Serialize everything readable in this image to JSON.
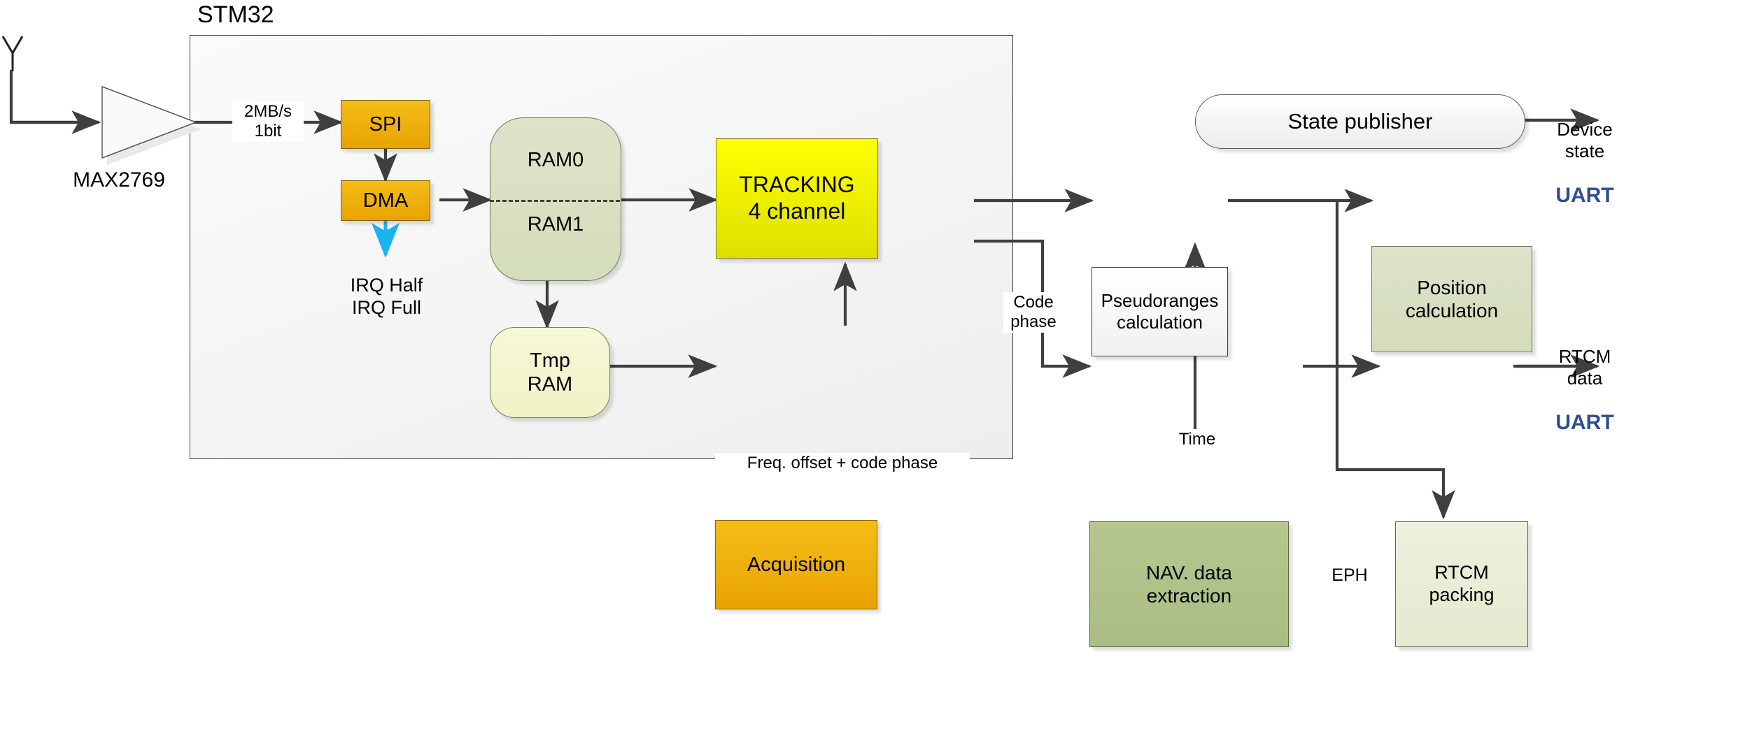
{
  "diagram": {
    "title": "STM32",
    "enclosure_label": "STM32"
  },
  "external": {
    "antenna": "antenna-icon",
    "amplifier_label": "MAX2769",
    "input_rate_line1": "2MB/s",
    "input_rate_line2": "1bit"
  },
  "blocks": {
    "spi": "SPI",
    "dma": "DMA",
    "ram_top": "RAM0",
    "ram_bottom": "RAM1",
    "tmp_ram_line1": "Tmp",
    "tmp_ram_line2": "RAM",
    "tracking_line1": "TRACKING",
    "tracking_line2": "4 channel",
    "acquisition": "Acquisition",
    "pseudoranges_line1": "Pseudoranges",
    "pseudoranges_line2": "calculation",
    "position_line1": "Position",
    "position_line2": "calculation",
    "nav_line1": "NAV. data",
    "nav_line2": "extraction",
    "rtcm_line1": "RTCM",
    "rtcm_line2": "packing",
    "state_publisher": "State publisher"
  },
  "labels": {
    "irq_half": "IRQ Half",
    "irq_full": "IRQ Full",
    "freq_offset": "Freq. offset + code phase",
    "code_phase_line1": "Code",
    "code_phase_line2": "phase",
    "time": "Time",
    "eph": "EPH",
    "device_state_line1": "Device",
    "device_state_line2": "state",
    "device_state_bus": "UART",
    "rtcm_data_line1": "RTCM",
    "rtcm_data_line2": "data",
    "rtcm_data_bus": "UART"
  },
  "colors": {
    "orange": "#efac06",
    "yellow": "#eded00",
    "green_dark": "#b0c288",
    "green_pale": "#d8e0c0",
    "cream": "#f2f6cc",
    "wire": "#3f3f3f",
    "irq_arrow": "#1cb4ef",
    "uart_text": "#2f4f8f",
    "enclosure_bg": "#f5f5f5"
  }
}
